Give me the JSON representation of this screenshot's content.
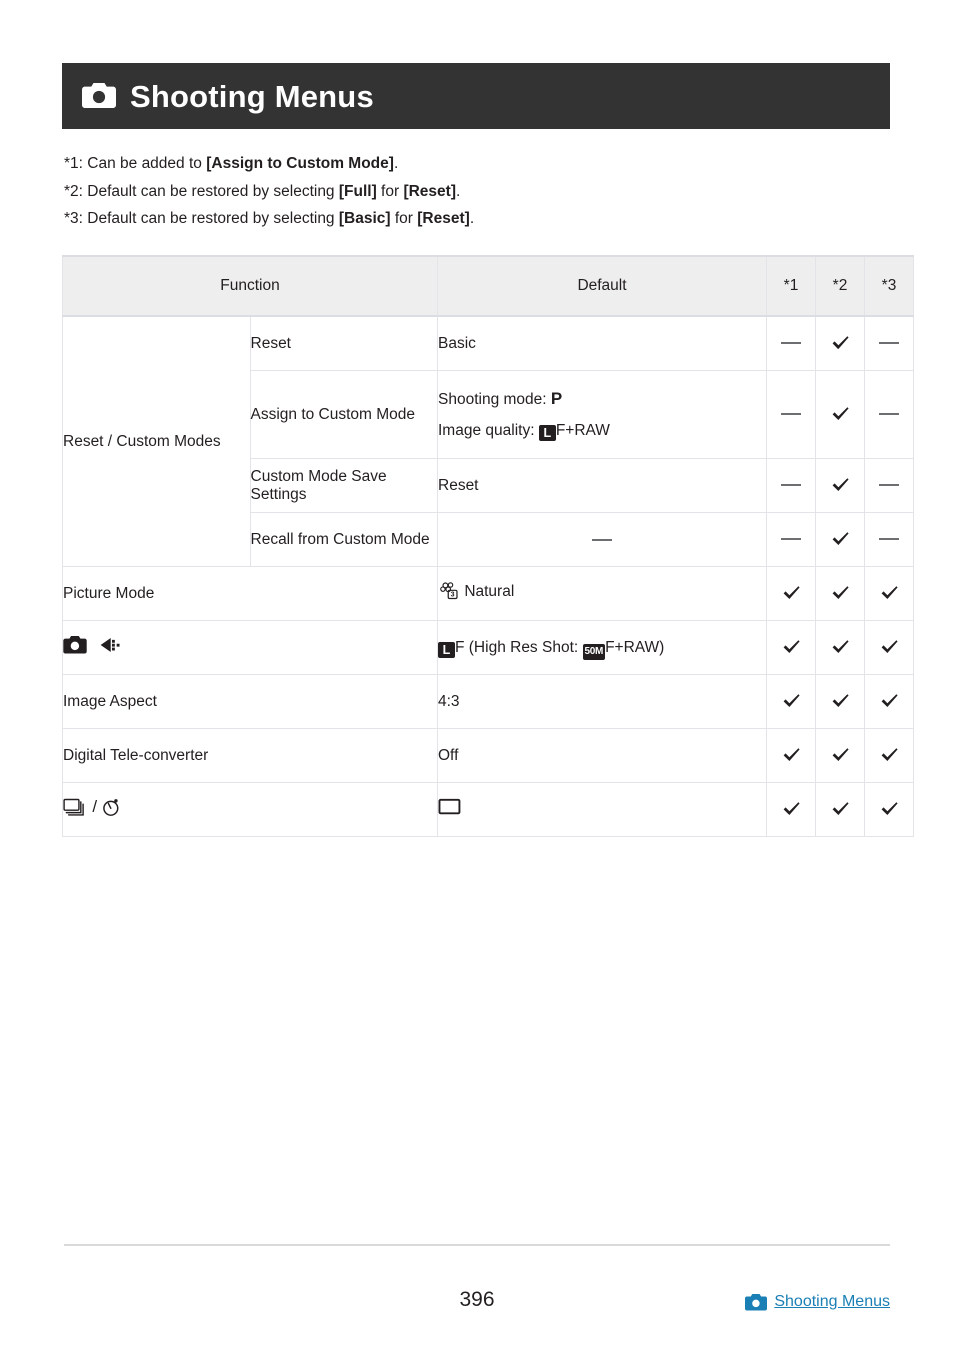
{
  "banner": {
    "icon": "camera-icon",
    "title": "Shooting Menus"
  },
  "footnotes": [
    {
      "marker": "*1:",
      "text_before": " Can be added to ",
      "bold1": "[Assign to Custom Mode]",
      "text_after": "."
    },
    {
      "marker": "*2:",
      "text_before": " Default can be restored by selecting ",
      "bold1": "[Full]",
      "mid": " for ",
      "bold2": "[Reset]",
      "text_after": "."
    },
    {
      "marker": "*3:",
      "text_before": " Default can be restored by selecting ",
      "bold1": "[Basic]",
      "mid": " for ",
      "bold2": "[Reset]",
      "text_after": "."
    }
  ],
  "table": {
    "headers": {
      "function": "Function",
      "default": "Default",
      "star1": "*1",
      "star2": "*2",
      "star3": "*3"
    },
    "group_label": "Reset / Custom Modes",
    "rows": [
      {
        "function": "Reset",
        "default": "Basic",
        "star1": "dash",
        "star2": "check",
        "star3": "dash"
      },
      {
        "function": "Assign to Custom Mode",
        "default_line1_label": "Shooting mode:",
        "default_line1_value": "P",
        "default_line2_label": "Image quality:",
        "default_line2_badge": "L",
        "default_line2_value": "F+RAW",
        "star1": "dash",
        "star2": "check",
        "star3": "dash"
      },
      {
        "function": "Custom Mode Save Settings",
        "default": "Reset",
        "star1": "dash",
        "star2": "check",
        "star3": "dash"
      },
      {
        "function": "Recall from Custom Mode",
        "default": "—",
        "star1": "dash",
        "star2": "check",
        "star3": "dash"
      },
      {
        "function": "Picture Mode",
        "default_icon": "picture-mode-natural-icon",
        "default": "Natural",
        "star1": "check",
        "star2": "check",
        "star3": "check"
      },
      {
        "function_icon1": "camera-icon",
        "function_icon2": "image-quality-icon",
        "default_badge": "L",
        "default_text1": "F (High Res Shot:",
        "default_badge2": "50M",
        "default_text2": "F+RAW)",
        "star1": "check",
        "star2": "check",
        "star3": "check"
      },
      {
        "function": "Image Aspect",
        "default": "4:3",
        "star1": "check",
        "star2": "check",
        "star3": "check"
      },
      {
        "function": "Digital Tele-converter",
        "default": "Off",
        "star1": "check",
        "star2": "check",
        "star3": "check"
      },
      {
        "function_icon1": "sequential-shooting-icon",
        "function_separator": "/",
        "function_icon2": "self-timer-icon",
        "default_icon": "single-frame-icon",
        "star1": "check",
        "star2": "check",
        "star3": "check"
      }
    ]
  },
  "footer": {
    "page_number": "396",
    "link_icon": "camera-icon",
    "link_label": "Shooting Menus",
    "link_color": "#1a7fb5"
  }
}
